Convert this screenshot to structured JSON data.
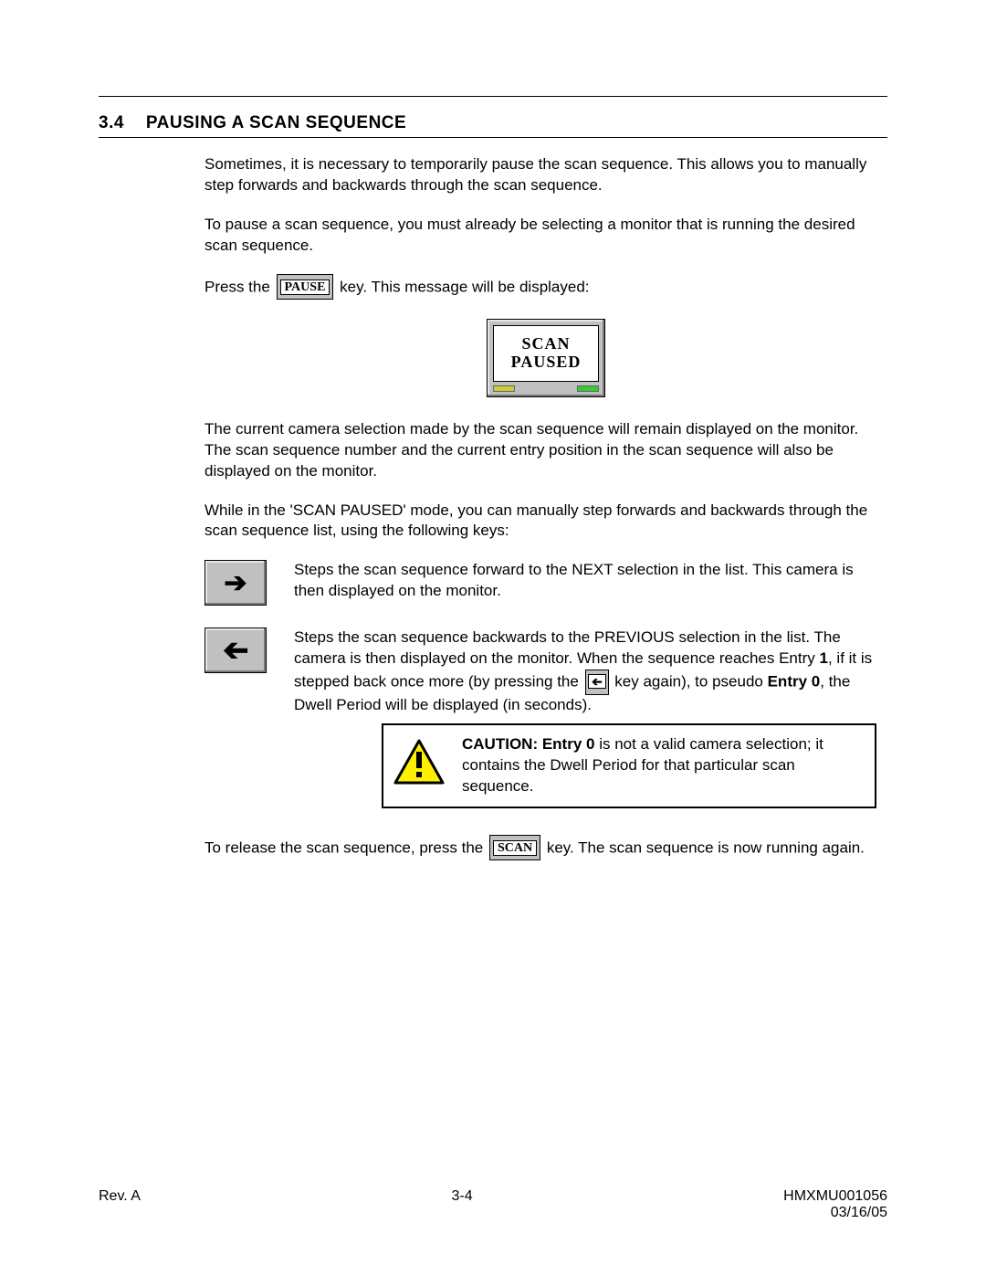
{
  "section": {
    "number": "3.4",
    "title": "PAUSING A SCAN SEQUENCE"
  },
  "para1": "Sometimes, it is necessary to temporarily pause the scan sequence.  This allows you to manually step forwards and backwards through the scan sequence.",
  "para2": "To pause a scan sequence, you must already be selecting a monitor that is running the desired scan sequence.",
  "press_pre": "Press the ",
  "pause_key": "PAUSE",
  "press_post": " key.  This message will be displayed:",
  "monitor": {
    "line1": "SCAN",
    "line2": "PAUSED"
  },
  "para3": "The current camera selection made by the scan sequence will remain displayed on the monitor.  The scan sequence number and the current entry position in the scan sequence will also be displayed on the monitor.",
  "para4": "While in the 'SCAN PAUSED' mode, you can manually step forwards and backwards through the scan sequence list, using the following keys:",
  "forward_desc": "Steps the scan sequence forward to the NEXT selection in the list.  This camera is then displayed on the monitor.",
  "back_desc_a": "Steps the scan sequence backwards to the PREVIOUS selection in the list.  The camera is then displayed on the monitor.  When the sequence reaches Entry ",
  "entry1": "1",
  "back_desc_b": ", if it is stepped back once more (by pressing the ",
  "back_desc_c": " key again), to pseudo ",
  "entry0_bold": "Entry 0",
  "back_desc_d": ", the Dwell Period will be displayed (in seconds).",
  "caution_bold": "CAUTION:  Entry 0",
  "caution_rest": " is not a valid camera selection; it contains the Dwell Period for that particular scan sequence.",
  "release_pre": "To release the scan sequence, press the ",
  "scan_key": "SCAN",
  "release_post": " key.  The scan sequence is now running again.",
  "footer": {
    "rev": "Rev. A",
    "page": "3-4",
    "doc": "HMXMU001056",
    "date": "03/16/05"
  }
}
